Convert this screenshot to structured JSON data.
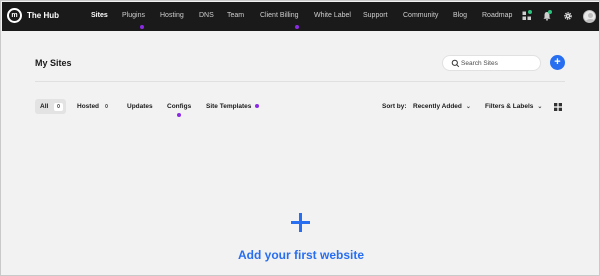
{
  "app": {
    "brand": "The Hub",
    "logo_letter": "m"
  },
  "nav": {
    "items": [
      {
        "label": "Sites",
        "active": true
      },
      {
        "label": "Plugins",
        "dot": true
      },
      {
        "label": "Hosting"
      },
      {
        "label": "DNS"
      },
      {
        "label": "Team"
      },
      {
        "label": "Client Billing",
        "dot": true
      },
      {
        "label": "White Label"
      },
      {
        "label": "Support"
      },
      {
        "label": "Community"
      },
      {
        "label": "Blog"
      },
      {
        "label": "Roadmap"
      }
    ]
  },
  "page": {
    "title": "My Sites",
    "search_placeholder": "Search Sites",
    "add_label": "+"
  },
  "filters": {
    "all": {
      "label": "All",
      "count": "0"
    },
    "hosted": {
      "label": "Hosted",
      "count": "0"
    },
    "updates": "Updates",
    "configs": "Configs",
    "site_templates": "Site Templates"
  },
  "sort": {
    "label": "Sort by:",
    "value": "Recently Added",
    "filters_labels": "Filters & Labels"
  },
  "empty_state": {
    "icon": "plus-icon",
    "text": "Add your first website"
  },
  "colors": {
    "accent": "#286ef1",
    "nav_bg": "#1a1a1a",
    "dot": "#8a2be2",
    "notify": "#2ec27e"
  }
}
